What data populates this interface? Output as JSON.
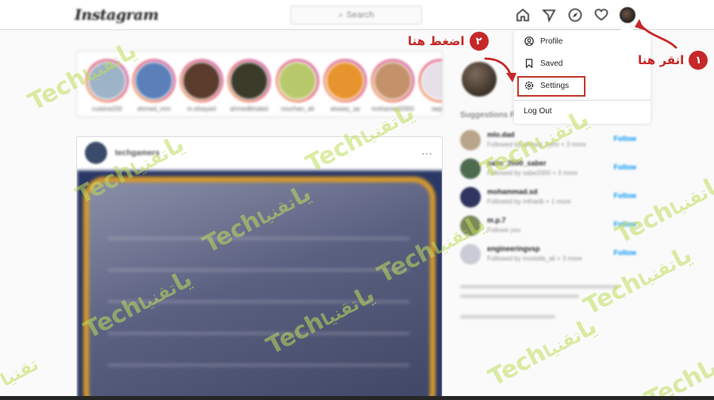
{
  "nav": {
    "logo": "Instagram",
    "search_placeholder": "Search",
    "icons": [
      "home-icon",
      "direct-icon",
      "explore-icon",
      "activity-heart-icon",
      "profile-avatar"
    ]
  },
  "stories": [
    {
      "username": "cuisine200"
    },
    {
      "username": "ahmed_mm"
    },
    {
      "username": "m.elsayed"
    },
    {
      "username": "ahmedkhaled"
    },
    {
      "username": "nourhan_ali"
    },
    {
      "username": "elsawy_sp"
    },
    {
      "username": "mohamed2000"
    },
    {
      "username": "taqnia"
    }
  ],
  "post": {
    "username": "techgamers",
    "more": "···"
  },
  "right_column": {
    "suggestions_title": "Suggestions For You",
    "suggestions": [
      {
        "name": "mlo.dad",
        "sub": "Followed by ahmed_vethi + 3 more",
        "action": "Follow"
      },
      {
        "name": "sabe_2000_saber",
        "sub": "Followed by sabe2000 + 3 more",
        "action": "Follow"
      },
      {
        "name": "mohammad.sd",
        "sub": "Followed by mtharib + 1 more",
        "action": "Follow"
      },
      {
        "name": "m.p.7",
        "sub": "Follows you",
        "action": "Follow"
      },
      {
        "name": "engineeringvsp",
        "sub": "Followed by mostafa_ali + 3 more",
        "action": "Follow"
      }
    ]
  },
  "dropdown": {
    "profile": "Profile",
    "saved": "Saved",
    "settings": "Settings",
    "logout": "Log Out"
  },
  "annotations": {
    "step1_text": "انقر هنا",
    "step1_num": "١",
    "step2_text": "اضغط هنا",
    "step2_num": "٢"
  },
  "watermark": {
    "latin": "Techیا",
    "arabic": "تقنيا"
  },
  "colors": {
    "highlight": "#c0392b",
    "annotation": "#c62828",
    "link_blue": "#0095f6",
    "watermark": "#bedc5a"
  }
}
